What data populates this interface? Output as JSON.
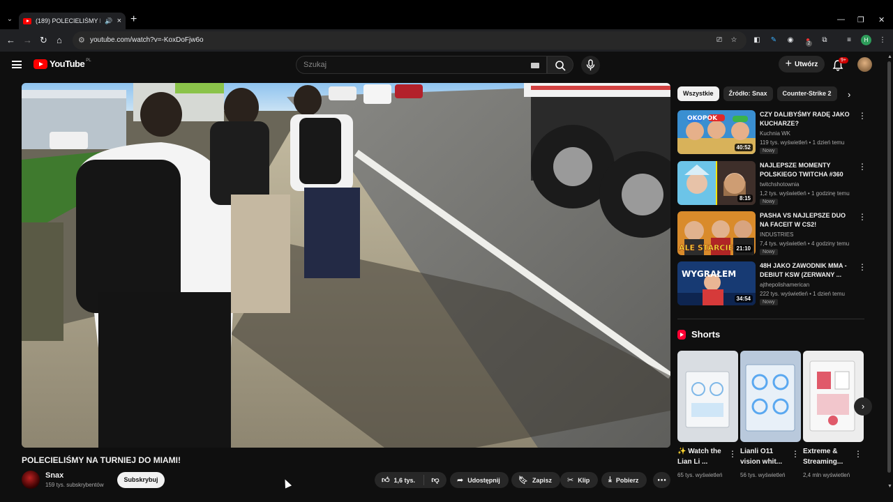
{
  "browser": {
    "tab_title": "(189) POLECIELIŚMY NA TU",
    "url": "youtube.com/watch?v=-KoxDoFjw6o",
    "profile_initial": "H",
    "ext_badge": "2"
  },
  "header": {
    "logo_text": "YouTube",
    "country_code": "PL",
    "search_placeholder": "Szukaj",
    "create_label": "Utwórz",
    "notif_badge": "9+"
  },
  "video": {
    "title": "POLECIELIŚMY NA TURNIEJ DO MIAMI!",
    "channel": "Snax",
    "subscribers": "159 tys. subskrybentów",
    "subscribe_label": "Subskrybuj",
    "likes": "1,6 tys.",
    "share_label": "Udostępnij",
    "save_label": "Zapisz",
    "clip_label": "Klip",
    "download_label": "Pobierz"
  },
  "chips": [
    "Wszystkie",
    "Źródło: Snax",
    "Counter-Strike 2"
  ],
  "recommendations": [
    {
      "title": "CZY DALIBYŚMY RADĘ JAKO KUCHARZE?",
      "channel": "Kuchnia WK",
      "meta": "119 tys. wyświetleń • 1 dzień temu",
      "badge": "Nowy",
      "duration": "40:52"
    },
    {
      "title": "NAJLEPSZE MOMENTY POLSKIEGO TWITCHA #360",
      "channel": "twitchshotownia",
      "meta": "1,2 tys. wyświetleń • 1 godzinę temu",
      "badge": "Nowy",
      "duration": "8:15"
    },
    {
      "title": "PASHA VS NAJLEPSZE DUO NA FACEIT W CS2!",
      "channel": "INDUSTRIES",
      "meta": "7,4 tys. wyświetleń • 4 godziny temu",
      "badge": "Nowy",
      "duration": "21:10"
    },
    {
      "title": "48H JAKO ZAWODNIK MMA - DEBIUT KSW (ZERWANY ...",
      "channel": "ajthepolishamerican",
      "meta": "222 tys. wyświetleń • 1 dzień temu",
      "badge": "Nowy",
      "duration": "34:54"
    }
  ],
  "thumb_text": {
    "t1": "OKOPOK",
    "t3": "ALE STARCIE",
    "t4": "WYGRAŁEM"
  },
  "shorts": {
    "heading": "Shorts",
    "items": [
      {
        "title": "✨ Watch the Lian Li ...",
        "views": "65 tys. wyświetleń"
      },
      {
        "title": "Lianli O11 vision whit...",
        "views": "56 tys. wyświetleń"
      },
      {
        "title": "Extreme & Streaming...",
        "views": "2,4 mln wyświetleń"
      }
    ]
  }
}
